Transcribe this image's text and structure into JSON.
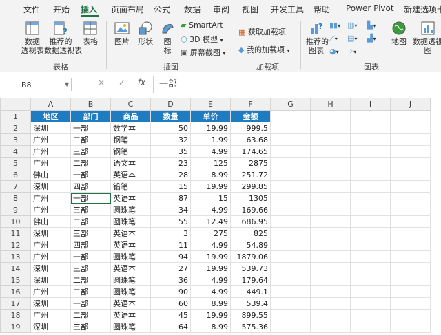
{
  "tabs": [
    "文件",
    "开始",
    "插入",
    "页面布局",
    "公式",
    "数据",
    "审阅",
    "视图",
    "开发工具",
    "帮助",
    "Power Pivot",
    "新建选项卡"
  ],
  "active_tab": "插入",
  "ribbon": {
    "pivot_table": "数据\n透视表",
    "recommended_pivot": "推荐的\n数据透视表",
    "table": "表格",
    "group_tables": "表格",
    "pictures": "图片",
    "shapes": "形状",
    "icons": "图\n标",
    "smartart": "SmartArt",
    "model3d": "3D 模型",
    "screenshot": "屏幕截图",
    "group_illustrations": "插图",
    "get_addins": "获取加载项",
    "my_addins": "我的加载项",
    "group_addins": "加载项",
    "recommended_charts": "推荐的\n图表",
    "maps": "地图",
    "pivot_chart": "数据透视图",
    "group_charts": "图表"
  },
  "formula_bar": {
    "name_box": "B8",
    "cancel": "×",
    "enter": "✓",
    "fx": "fx",
    "content": "一部"
  },
  "columns": [
    "A",
    "B",
    "C",
    "D",
    "E",
    "F",
    "G",
    "H",
    "I",
    "J"
  ],
  "header_row": [
    "地区",
    "部门",
    "商品",
    "数量",
    "单价",
    "金额"
  ],
  "rows": [
    [
      "深圳",
      "一部",
      "数学本",
      "50",
      "19.99",
      "999.5"
    ],
    [
      "广州",
      "二部",
      "钢笔",
      "32",
      "1.99",
      "63.68"
    ],
    [
      "广州",
      "三部",
      "钢笔",
      "35",
      "4.99",
      "174.65"
    ],
    [
      "广州",
      "二部",
      "语文本",
      "23",
      "125",
      "2875"
    ],
    [
      "佛山",
      "一部",
      "英语本",
      "28",
      "8.99",
      "251.72"
    ],
    [
      "深圳",
      "四部",
      "铅笔",
      "15",
      "19.99",
      "299.85"
    ],
    [
      "广州",
      "一部",
      "英语本",
      "87",
      "15",
      "1305"
    ],
    [
      "广州",
      "三部",
      "圆珠笔",
      "34",
      "4.99",
      "169.66"
    ],
    [
      "佛山",
      "二部",
      "圆珠笔",
      "55",
      "12.49",
      "686.95"
    ],
    [
      "深圳",
      "三部",
      "英语本",
      "3",
      "275",
      "825"
    ],
    [
      "广州",
      "四部",
      "英语本",
      "11",
      "4.99",
      "54.89"
    ],
    [
      "广州",
      "一部",
      "圆珠笔",
      "94",
      "19.99",
      "1879.06"
    ],
    [
      "深圳",
      "三部",
      "英语本",
      "27",
      "19.99",
      "539.73"
    ],
    [
      "深圳",
      "二部",
      "圆珠笔",
      "36",
      "4.99",
      "179.64"
    ],
    [
      "广州",
      "二部",
      "圆珠笔",
      "90",
      "4.99",
      "449.1"
    ],
    [
      "深圳",
      "一部",
      "英语本",
      "60",
      "8.99",
      "539.4"
    ],
    [
      "广州",
      "二部",
      "英语本",
      "45",
      "19.99",
      "899.55"
    ],
    [
      "深圳",
      "三部",
      "圆珠笔",
      "64",
      "8.99",
      "575.36"
    ]
  ],
  "colors": {
    "excel_green": "#217346",
    "header_fill": "#1f7cc1",
    "header_text": "#ffffff"
  }
}
